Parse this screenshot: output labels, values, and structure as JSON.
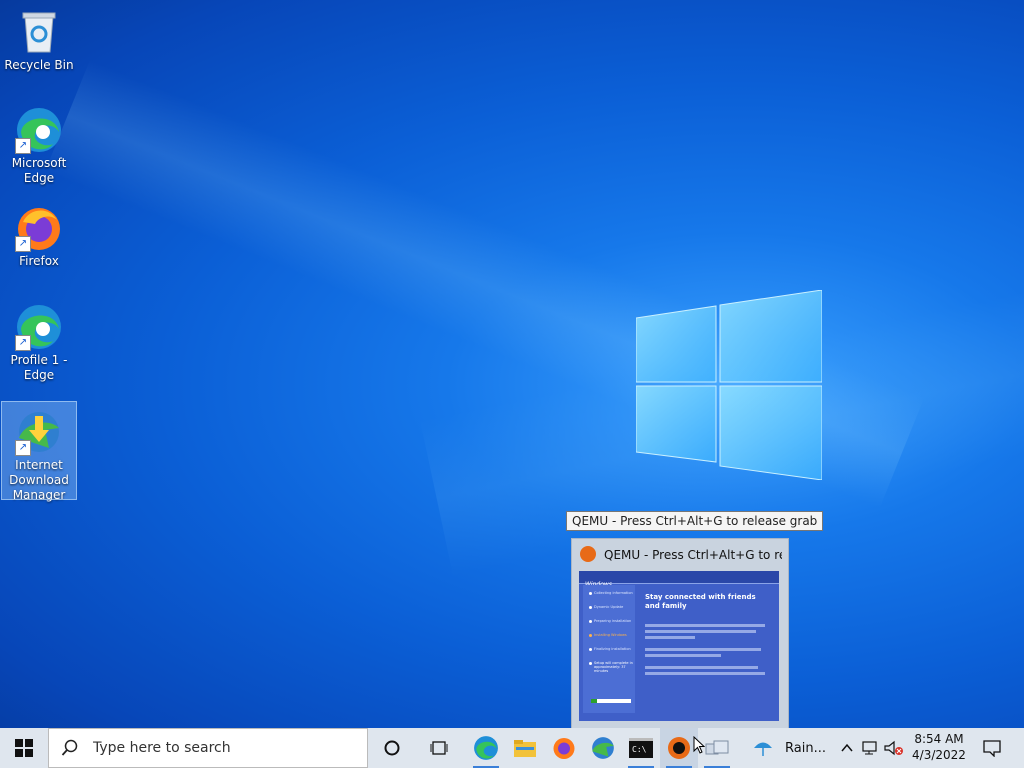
{
  "desktop": {
    "icons": [
      {
        "label": "Recycle Bin"
      },
      {
        "label": "Microsoft Edge"
      },
      {
        "label": "Firefox"
      },
      {
        "label": "Profile 1 - Edge"
      },
      {
        "label": "Internet Download Manager"
      }
    ]
  },
  "tooltip": {
    "text": "QEMU - Press Ctrl+Alt+G to release grab"
  },
  "preview": {
    "title": "QEMU - Press Ctrl+Alt+G to rel...",
    "xp": {
      "brand": "Windows",
      "steps": [
        "Collecting information",
        "Dynamic Update",
        "Preparing installation",
        "Installing Windows",
        "Finalizing installation"
      ],
      "active_step": 3,
      "heading": "Stay connected with friends and family",
      "remaining": "Setup will complete in approximately: 37 minutes"
    }
  },
  "taskbar": {
    "search_placeholder": "Type here to search",
    "apps": [
      "cortana-icon",
      "task-view-icon",
      "edge-icon",
      "file-explorer-icon",
      "firefox-icon",
      "idm-icon",
      "cmd-icon",
      "qemu-icon",
      "network-icon"
    ],
    "weather": "Rain...",
    "time": "8:54 AM",
    "date": "4/3/2022"
  },
  "colors": {
    "taskbar": "#dfe6ee",
    "accent": "#3a7fd8",
    "desktop": "#0b5fd6"
  }
}
